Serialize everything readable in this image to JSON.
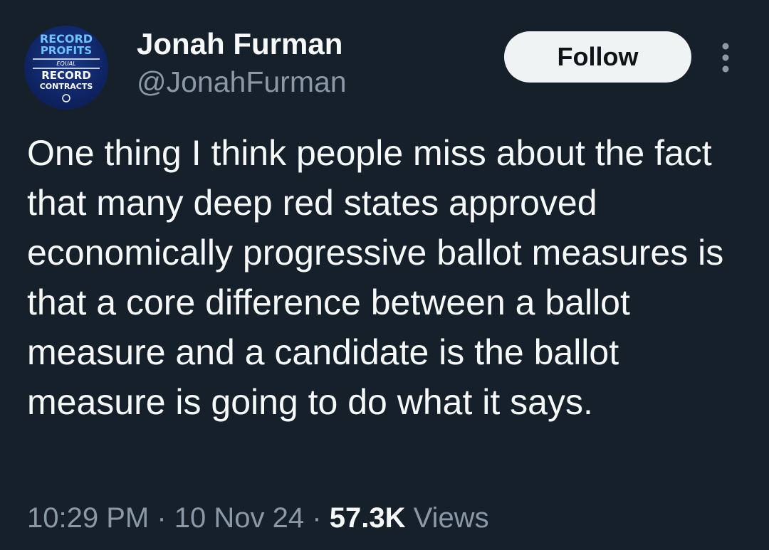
{
  "author": {
    "name": "Jonah Furman",
    "handle": "@JonahFurman",
    "avatar_text": {
      "line1": "RECORD",
      "line2": "PROFITS",
      "line3": "EQUAL",
      "line4": "RECORD",
      "line5": "CONTRACTS"
    }
  },
  "actions": {
    "follow_label": "Follow",
    "more_icon": "more-dots-icon"
  },
  "tweet": {
    "text": "One thing I think people miss about the fact that many deep red states approved economically progressive ballot measures is that a core difference between a ballot measure and a candidate is the ballot measure is going to do what it says."
  },
  "meta": {
    "time": "10:29 PM",
    "separator": "·",
    "date": "10 Nov 24",
    "views_count": "57.3K",
    "views_label": "Views"
  },
  "colors": {
    "background": "#15202b",
    "text": "#f7f9f9",
    "secondary": "#8b98a5",
    "button_bg": "#eff3f4",
    "avatar_blue": "#1a3a8c"
  }
}
